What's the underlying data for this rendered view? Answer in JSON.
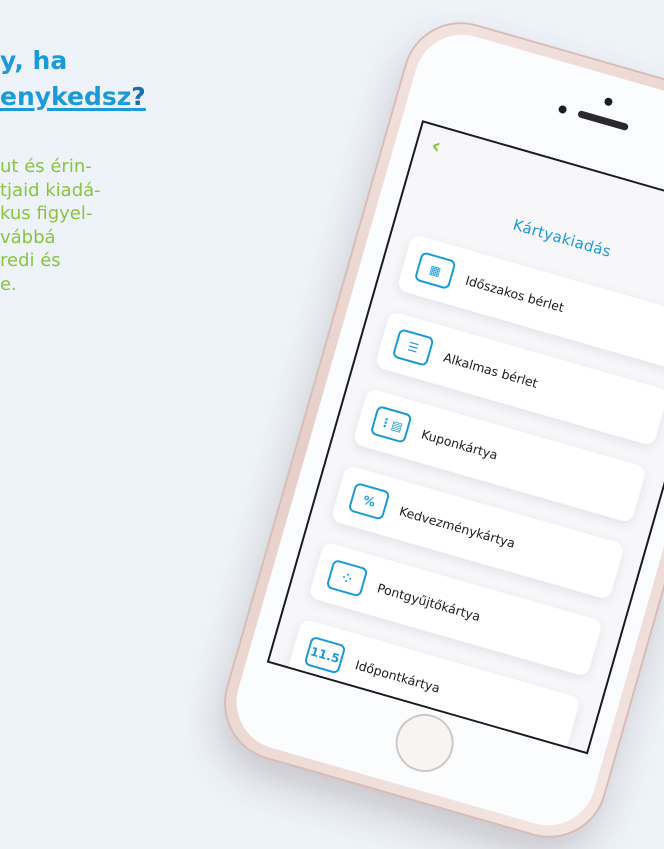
{
  "promo": {
    "heading_line1": "y, ha",
    "heading_line2": "enykedsz",
    "heading_q": "?",
    "body_lines": [
      "ut és érin-",
      "tjaid kiadá-",
      "kus figyel-",
      "vábbá",
      "redi és",
      "e."
    ]
  },
  "app": {
    "back_icon": "chevron-left-icon",
    "title": "Kártyakiadás",
    "cards": [
      {
        "label": "Időszakos bérlet",
        "icon": "calendar-icon",
        "glyph": "▦"
      },
      {
        "label": "Alkalmas bérlet",
        "icon": "ticket-lines-icon",
        "glyph": "☰"
      },
      {
        "label": "Kuponkártya",
        "icon": "coupon-icon",
        "glyph": "⋮▤"
      },
      {
        "label": "Kedvezménykártya",
        "icon": "percent-icon",
        "glyph": "%"
      },
      {
        "label": "Pontgyűjtőkártya",
        "icon": "points-grid-icon",
        "glyph": "⁘"
      },
      {
        "label": "Időpontkártya",
        "icon": "date-card-icon",
        "glyph": "11.5"
      }
    ]
  },
  "colors": {
    "accent": "#1a9ad8",
    "green": "#8ac43e",
    "text": "#1c1c22"
  }
}
